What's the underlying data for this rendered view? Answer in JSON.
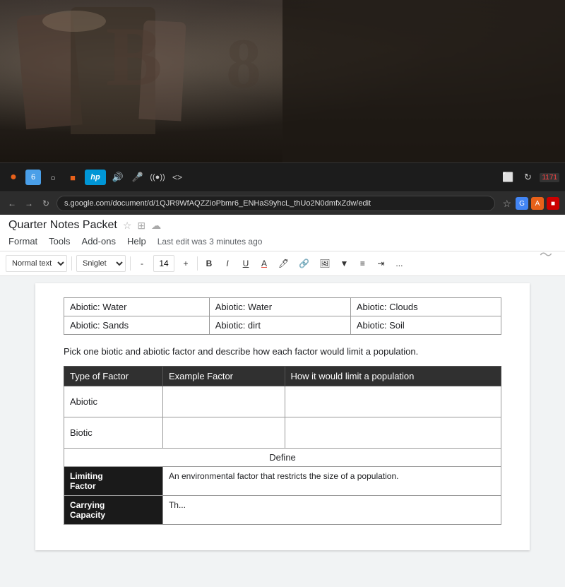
{
  "photo": {
    "alt": "Background photo showing clothing on hangers"
  },
  "taskbar": {
    "icons": [
      {
        "name": "orange-circle",
        "symbol": "●",
        "color": "orange"
      },
      {
        "name": "tab-6",
        "symbol": "6",
        "color": "#4a9fe8"
      },
      {
        "name": "circle-outline",
        "symbol": "○",
        "color": "#aaa"
      },
      {
        "name": "orange-square",
        "symbol": "■",
        "color": "#e8611a"
      },
      {
        "name": "hp-logo",
        "symbol": "hp",
        "color": "white"
      },
      {
        "name": "volume-icon",
        "symbol": "🔊",
        "color": "#aaa"
      },
      {
        "name": "mic-icon",
        "symbol": "🎤",
        "color": "#aaa"
      },
      {
        "name": "radio-icon",
        "symbol": "((●))",
        "color": "#aaa"
      },
      {
        "name": "code-icon",
        "symbol": "<>",
        "color": "#aaa"
      },
      {
        "name": "monitor-icon",
        "symbol": "⬛",
        "color": "#aaa"
      },
      {
        "name": "refresh-icon",
        "symbol": "↻",
        "color": "#aaa"
      }
    ],
    "num_badge": "1171"
  },
  "address_bar": {
    "url": "s.google.com/document/d/1QJR9WfAQZZioPbmr6_ENHaS9yhcL_thUo2N0dmfxZdw/edit",
    "nav_icons": [
      "←",
      "→",
      "↻"
    ]
  },
  "docs": {
    "title": "Quarter Notes Packet",
    "menu_items": [
      "Format",
      "Tools",
      "Add-ons",
      "Help"
    ],
    "last_edit": "Last edit was 3 minutes ago",
    "toolbar": {
      "style_dropdown": "Normal text",
      "font_dropdown": "Sniglet",
      "font_size_minus": "-",
      "font_size": "14",
      "font_size_plus": "+",
      "bold": "B",
      "italic": "I",
      "underline": "U",
      "font_color": "A",
      "more": "..."
    },
    "abiotic_table": {
      "rows": [
        [
          "Abiotic: Water",
          "Abiotic: Water",
          "Abiotic: Clouds"
        ],
        [
          "Abiotic: Sands",
          "Abiotic: dirt",
          "Abiotic: Soil"
        ]
      ]
    },
    "instruction_text": "Pick one biotic and abiotic factor and describe how each factor would limit a population.",
    "factor_table": {
      "headers": [
        "Type of Factor",
        "Example Factor",
        "How it would limit a population"
      ],
      "rows": [
        [
          "Abiotic",
          "",
          ""
        ],
        [
          "Biotic",
          "",
          ""
        ]
      ]
    },
    "define_label": "Define",
    "limiting_factor": {
      "term": "Limiting\nFactor",
      "definition": "An environmental factor that restricts the size of a population."
    },
    "carrying_factor": {
      "term": "Carrying\nCapacity",
      "definition": "The..."
    }
  }
}
